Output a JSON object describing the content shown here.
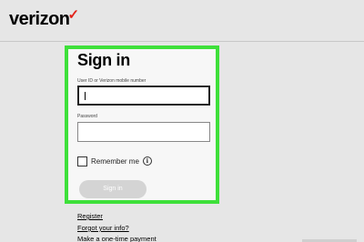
{
  "header": {
    "logo_text": "verizon",
    "logo_mark": "✓",
    "accent_color": "#e2231a"
  },
  "highlight_color": "#3ee03a",
  "signin": {
    "title": "Sign in",
    "user_id_label": "User ID or Verizon mobile number",
    "user_id_value": "",
    "password_label": "Password",
    "password_value": "",
    "remember_label": "Remember me",
    "info_icon": "info-icon",
    "info_glyph": "i",
    "button_label": "Sign in"
  },
  "links": {
    "register": "Register",
    "forgot": "Forgot your info?",
    "payment": "Make a one-time payment"
  }
}
